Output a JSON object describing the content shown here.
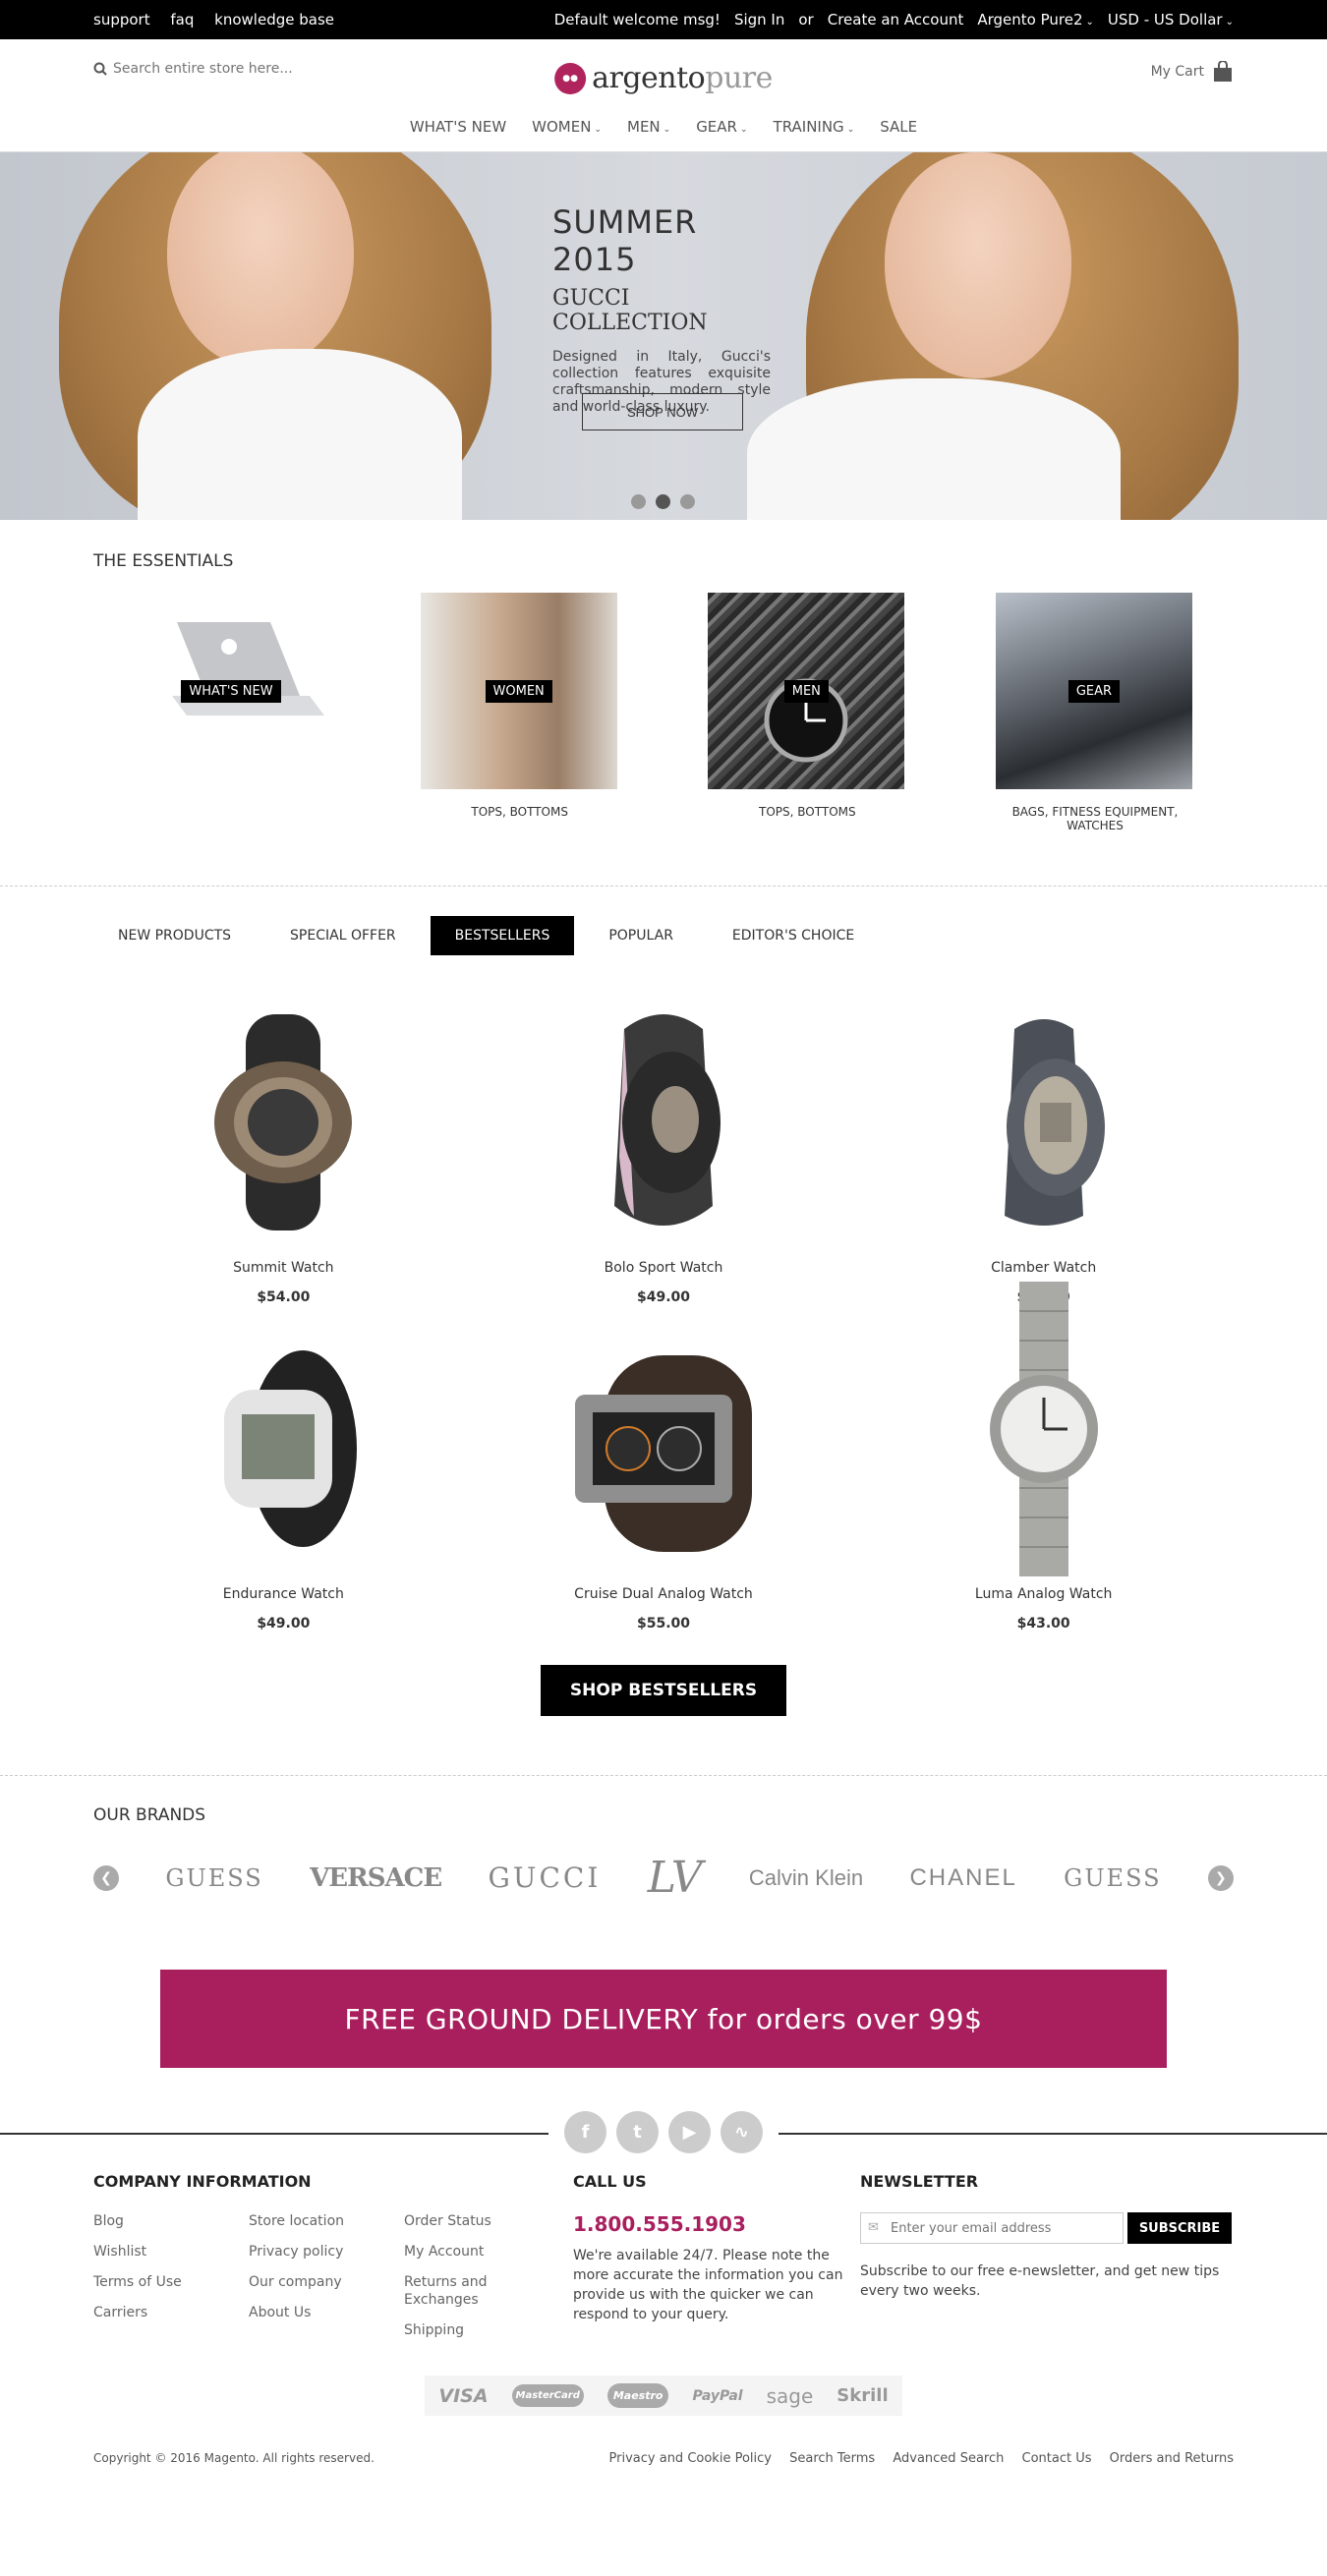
{
  "topbar": {
    "links": [
      "support",
      "faq",
      "knowledge base"
    ],
    "welcome": "Default welcome msg!",
    "sign_in": "Sign In",
    "or": "or",
    "create_account": "Create an Account",
    "store": "Argento Pure2",
    "currency": "USD - US Dollar"
  },
  "header": {
    "search_placeholder": "Search entire store here...",
    "logo_a": "argento",
    "logo_b": "pure",
    "cart": "My Cart"
  },
  "nav": [
    "WHAT'S NEW",
    "WOMEN",
    "MEN",
    "GEAR",
    "TRAINING",
    "SALE"
  ],
  "hero": {
    "title": "SUMMER 2015",
    "subtitle": "GUCCI COLLECTION",
    "text": "Designed in Italy, Gucci's collection features exquisite craftsmanship, modern style and world-class luxury.",
    "button": "SHOP NOW"
  },
  "essentials": {
    "title": "THE ESSENTIALS",
    "items": [
      {
        "label": "WHAT'S NEW",
        "sub": ""
      },
      {
        "label": "WOMEN",
        "sub": "TOPS, BOTTOMS"
      },
      {
        "label": "MEN",
        "sub": "TOPS, BOTTOMS"
      },
      {
        "label": "GEAR",
        "sub": "BAGS, FITNESS EQUIPMENT, WATCHES"
      }
    ]
  },
  "tabs": [
    "NEW PRODUCTS",
    "SPECIAL OFFER",
    "BESTSELLERS",
    "POPULAR",
    "EDITOR'S CHOICE"
  ],
  "products": [
    {
      "name": "Summit Watch",
      "price": "$54.00"
    },
    {
      "name": "Bolo Sport Watch",
      "price": "$49.00"
    },
    {
      "name": "Clamber Watch",
      "price": "$54.00"
    },
    {
      "name": "Endurance Watch",
      "price": "$49.00"
    },
    {
      "name": "Cruise Dual Analog Watch",
      "price": "$55.00"
    },
    {
      "name": "Luma Analog Watch",
      "price": "$43.00"
    }
  ],
  "shop_button": "SHOP BESTSELLERS",
  "brands": {
    "title": "OUR BRANDS",
    "items": [
      "GUESS",
      "VERSACE",
      "GUCCI",
      "LV",
      "Calvin Klein",
      "CHANEL",
      "GUESS"
    ]
  },
  "banner": "FREE GROUND DELIVERY for orders over 99$",
  "footer": {
    "company_title": "COMPANY INFORMATION",
    "col1": [
      "Blog",
      "Wishlist",
      "Terms of Use",
      "Carriers"
    ],
    "col2": [
      "Store location",
      "Privacy policy",
      "Our company",
      "About Us"
    ],
    "col3": [
      "Order Status",
      "My Account",
      "Returns and Exchanges",
      "Shipping"
    ],
    "call_title": "CALL US",
    "phone": "1.800.555.1903",
    "call_text": "We're available 24/7. Please note the more accurate the information you can provide us with the quicker we can respond to your query.",
    "news_title": "NEWSLETTER",
    "news_placeholder": "Enter your email address",
    "subscribe": "SUBSCRIBE",
    "news_text": "Subscribe to our free e-newsletter, and get new tips every two weeks.",
    "payments": [
      "VISA",
      "MasterCard",
      "Maestro",
      "PayPal",
      "sage",
      "Skrill"
    ],
    "copyright": "Copyright © 2016 Magento. All rights reserved.",
    "bottom_links": [
      "Privacy and Cookie Policy",
      "Search Terms",
      "Advanced Search",
      "Contact Us",
      "Orders and Returns"
    ]
  },
  "colors": {
    "accent": "#a91f5e",
    "black": "#000000"
  }
}
